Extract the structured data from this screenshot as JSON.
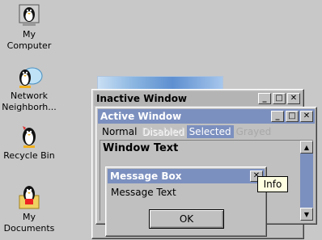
{
  "desktop": {
    "icons": [
      {
        "label": "My\nComputer",
        "icon": "computer-penguin-icon"
      },
      {
        "label": "Network\nNeighborh...",
        "icon": "network-penguin-icon"
      },
      {
        "label": "Recycle Bin",
        "icon": "recycle-penguin-icon"
      },
      {
        "label": "My\nDocuments",
        "icon": "documents-penguin-icon"
      }
    ]
  },
  "inactive_window": {
    "title": "Inactive Window",
    "buttons": {
      "minimize": "_",
      "maximize": "□",
      "close": "✕"
    }
  },
  "active_window": {
    "title": "Active Window",
    "buttons": {
      "minimize": "_",
      "maximize": "□",
      "close": "✕"
    },
    "menu": {
      "normal": "Normal",
      "disabled": "Disabled",
      "selected": "Selected",
      "grayed": "Grayed"
    },
    "window_text": "Window Text",
    "scrollbar": {
      "up": "▲",
      "down": "▼"
    }
  },
  "message_box": {
    "title": "Message Box",
    "close": "✕",
    "text": "Message Text",
    "ok_label": "OK"
  },
  "tooltip": {
    "text": "Info"
  },
  "colors": {
    "desktop": "#c8c8c8",
    "active_title": "#7c90bf",
    "inactive_title": "#b4b4b4",
    "tooltip_bg": "#ffffe1"
  }
}
